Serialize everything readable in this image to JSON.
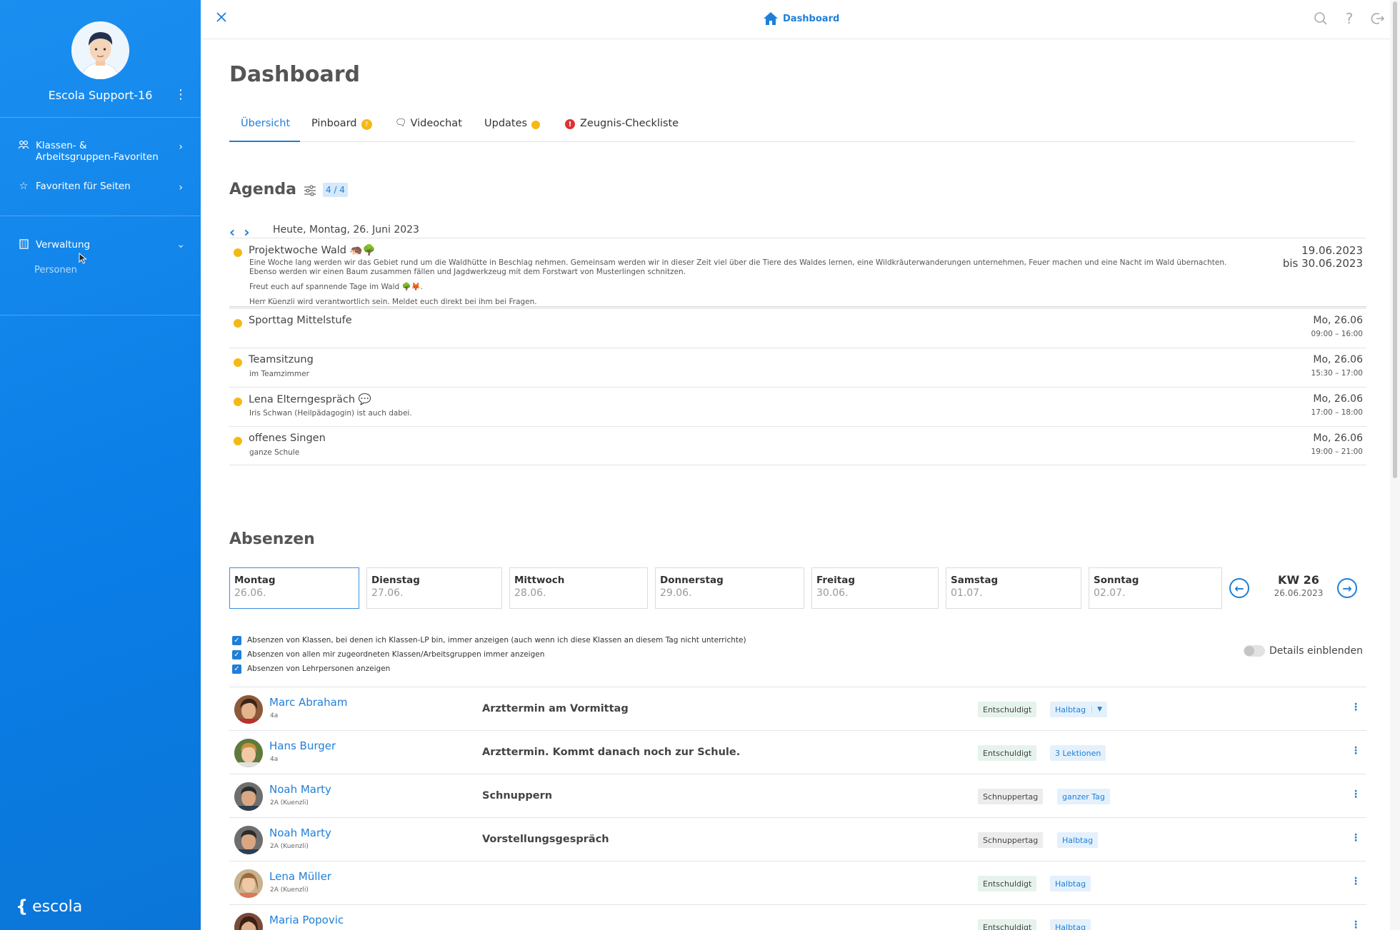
{
  "sidebar": {
    "user_name": "Escola Support-16",
    "items": [
      {
        "label": "Klassen- & Arbeitsgruppen-Favoriten",
        "icon": "group-icon"
      },
      {
        "label": "Favoriten für Seiten",
        "icon": "star-icon"
      },
      {
        "label": "Verwaltung",
        "icon": "building-icon",
        "subitems": [
          "Personen"
        ]
      }
    ],
    "logo": "escola"
  },
  "topbar": {
    "title": "Dashboard",
    "icons": [
      "search-icon",
      "help-icon",
      "logout-icon"
    ]
  },
  "page": {
    "title": "Dashboard"
  },
  "tabs": [
    {
      "label": "Übersicht",
      "active": true
    },
    {
      "label": "Pinboard",
      "badge": "?"
    },
    {
      "label": "Videochat"
    },
    {
      "label": "Updates",
      "dot": true
    },
    {
      "label": "Zeugnis-Checkliste",
      "warning": "!"
    }
  ],
  "agenda": {
    "title": "Agenda",
    "count": "4 / 4",
    "today": "Heute, Montag, 26. Juni 2023",
    "items": [
      {
        "title": "Projektwoche Wald 🦔🌳",
        "desc1": "Eine Woche lang werden wir das Gebiet rund um die Waldhütte in Beschlag nehmen. Gemeinsam werden wir in dieser Zeit viel über die Tiere des Waldes lernen, eine Wildkräuterwanderungen unternehmen, Feuer machen und eine Nacht im Wald übernachten.",
        "desc2": "Ebenso werden wir einen Baum zusammen fällen und Jagdwerkzeug mit dem Forstwart von Musterlingen schnitzen.",
        "desc3": "Freut euch auf spannende Tage im Wald 🌳🦊.",
        "desc4": "Herr Küenzli wird verantwortlich sein. Meldet euch direkt bei ihm bei Fragen.",
        "date1": "19.06.2023",
        "date2": "bis 30.06.2023"
      },
      {
        "title": "Sporttag Mittelstufe",
        "sub": "",
        "date1": "Mo, 26.06",
        "date2": "09:00 – 16:00"
      },
      {
        "title": "Teamsitzung",
        "sub": "im Teamzimmer",
        "date1": "Mo, 26.06",
        "date2": "15:30 – 17:00"
      },
      {
        "title": "Lena Elterngespräch 💬",
        "sub": "Iris Schwan (Heilpädagogin) ist auch dabei.",
        "date1": "Mo, 26.06",
        "date2": "17:00 – 18:00"
      },
      {
        "title": "offenes Singen",
        "sub": "ganze Schule",
        "date1": "Mo, 26.06",
        "date2": "19:00 – 21:00"
      }
    ]
  },
  "absences": {
    "title": "Absenzen",
    "days": [
      {
        "name": "Montag",
        "date": "26.06.",
        "selected": true
      },
      {
        "name": "Dienstag",
        "date": "27.06."
      },
      {
        "name": "Mittwoch",
        "date": "28.06."
      },
      {
        "name": "Donnerstag",
        "date": "29.06."
      },
      {
        "name": "Freitag",
        "date": "30.06."
      },
      {
        "name": "Samstag",
        "date": "01.07."
      },
      {
        "name": "Sonntag",
        "date": "02.07."
      }
    ],
    "week": "KW 26",
    "week_date": "26.06.2023",
    "checks": [
      "Absenzen von Klassen, bei denen ich Klassen-LP bin, immer anzeigen (auch wenn ich diese Klassen an diesem Tag nicht unterrichte)",
      "Absenzen von allen mir zugeordneten Klassen/Arbeitsgruppen immer anzeigen",
      "Absenzen von Lehrpersonen anzeigen"
    ],
    "details_label": "Details einblenden",
    "rows": [
      {
        "name": "Marc Abraham",
        "class": "4a",
        "reason": "Arzttermin am Vormittag",
        "status": "Entschuldigt",
        "duration": "Halbtag",
        "has_dropdown": true
      },
      {
        "name": "Hans Burger",
        "class": "4a",
        "reason": "Arzttermin. Kommt danach noch zur Schule.",
        "status": "Entschuldigt",
        "duration": "3 Lektionen"
      },
      {
        "name": "Noah Marty",
        "class": "2A (Kuenzli)",
        "reason": "Schnuppern",
        "status": "Schnuppertag",
        "duration": "ganzer Tag"
      },
      {
        "name": "Noah Marty",
        "class": "2A (Kuenzli)",
        "reason": "Vorstellungsgespräch",
        "status": "Schnuppertag",
        "duration": "Halbtag"
      },
      {
        "name": "Lena Müller",
        "class": "2A (Kuenzli)",
        "reason": "",
        "status": "Entschuldigt",
        "duration": "Halbtag"
      },
      {
        "name": "Maria Popovic",
        "class": "",
        "reason": "",
        "status": "Entschuldigt",
        "duration": "Halbtag"
      }
    ]
  },
  "colors": {
    "accent": "#1f7fd8",
    "sidebar": "#0b7fe6",
    "dot": "#f5b915"
  }
}
